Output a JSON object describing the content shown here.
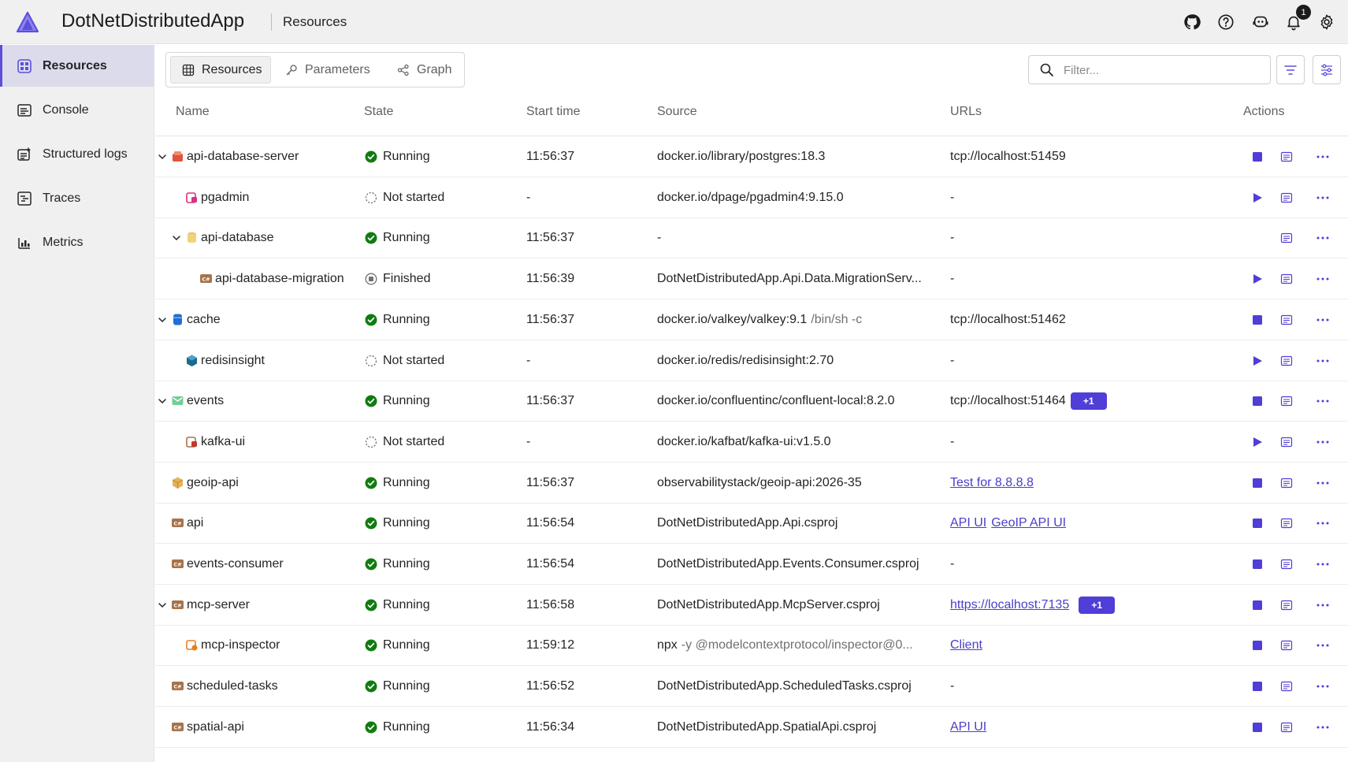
{
  "header": {
    "app_title": "DotNetDistributedApp",
    "crumb": "Resources",
    "notification_count": "1"
  },
  "sidebar": {
    "items": [
      {
        "label": "Resources",
        "icon": "resources-icon",
        "active": true
      },
      {
        "label": "Console",
        "icon": "console-icon",
        "active": false
      },
      {
        "label": "Structured logs",
        "icon": "structured-logs-icon",
        "active": false
      },
      {
        "label": "Traces",
        "icon": "traces-icon",
        "active": false
      },
      {
        "label": "Metrics",
        "icon": "metrics-icon",
        "active": false
      }
    ]
  },
  "tabs": [
    {
      "label": "Resources",
      "icon": "table-icon",
      "active": true
    },
    {
      "label": "Parameters",
      "icon": "key-icon",
      "active": false
    },
    {
      "label": "Graph",
      "icon": "graph-icon",
      "active": false
    }
  ],
  "filter": {
    "placeholder": "Filter..."
  },
  "columns": {
    "name": "Name",
    "state": "State",
    "start_time": "Start time",
    "source": "Source",
    "urls": "URLs",
    "actions": "Actions"
  },
  "colors": {
    "accent": "#5b4fdb",
    "running": "#107c10",
    "link": "#4a3fc7"
  },
  "rows": [
    {
      "name": "api-database-server",
      "level": 0,
      "expanded": true,
      "icon": "postgres-icon",
      "state": "Running",
      "start": "11:56:37",
      "source": "docker.io/library/postgres:18.3",
      "source_extra": "",
      "urls": [
        {
          "text": "tcp://localhost:51459",
          "link": false
        }
      ],
      "plus": "",
      "primary": "stop"
    },
    {
      "name": "pgadmin",
      "level": 1,
      "expanded": null,
      "icon": "pgadmin-icon",
      "state": "Not started",
      "start": "-",
      "source": "docker.io/dpage/pgadmin4:9.15.0",
      "source_extra": "",
      "urls": [
        {
          "text": "-",
          "link": false
        }
      ],
      "plus": "",
      "primary": "start"
    },
    {
      "name": "api-database",
      "level": 1,
      "expanded": true,
      "icon": "database-icon",
      "state": "Running",
      "start": "11:56:37",
      "source": "-",
      "source_extra": "",
      "urls": [
        {
          "text": "-",
          "link": false
        }
      ],
      "plus": "",
      "primary": "none"
    },
    {
      "name": "api-database-migration",
      "level": 2,
      "expanded": null,
      "icon": "csharp-project-icon",
      "state": "Finished",
      "start": "11:56:39",
      "source": "DotNetDistributedApp.Api.Data.MigrationServ...",
      "source_extra": "",
      "urls": [
        {
          "text": "-",
          "link": false
        }
      ],
      "plus": "",
      "primary": "start"
    },
    {
      "name": "cache",
      "level": 0,
      "expanded": true,
      "icon": "valkey-icon",
      "state": "Running",
      "start": "11:56:37",
      "source": "docker.io/valkey/valkey:9.1",
      "source_extra": "/bin/sh -c",
      "urls": [
        {
          "text": "tcp://localhost:51462",
          "link": false
        }
      ],
      "plus": "",
      "primary": "stop"
    },
    {
      "name": "redisinsight",
      "level": 1,
      "expanded": null,
      "icon": "redisinsight-icon",
      "state": "Not started",
      "start": "-",
      "source": "docker.io/redis/redisinsight:2.70",
      "source_extra": "",
      "urls": [
        {
          "text": "-",
          "link": false
        }
      ],
      "plus": "",
      "primary": "start"
    },
    {
      "name": "events",
      "level": 0,
      "expanded": true,
      "icon": "kafka-icon",
      "state": "Running",
      "start": "11:56:37",
      "source": "docker.io/confluentinc/confluent-local:8.2.0",
      "source_extra": "",
      "urls": [
        {
          "text": "tcp://localhost:51464",
          "link": false
        }
      ],
      "plus": "+1",
      "primary": "stop"
    },
    {
      "name": "kafka-ui",
      "level": 1,
      "expanded": null,
      "icon": "kafka-ui-icon",
      "state": "Not started",
      "start": "-",
      "source": "docker.io/kafbat/kafka-ui:v1.5.0",
      "source_extra": "",
      "urls": [
        {
          "text": "-",
          "link": false
        }
      ],
      "plus": "",
      "primary": "start"
    },
    {
      "name": "geoip-api",
      "level": 0,
      "expanded": null,
      "icon": "container-icon",
      "state": "Running",
      "start": "11:56:37",
      "source": "observabilitystack/geoip-api:2026-35",
      "source_extra": "",
      "urls": [
        {
          "text": "Test for 8.8.8.8",
          "link": true
        }
      ],
      "plus": "",
      "primary": "stop"
    },
    {
      "name": "api",
      "level": 0,
      "expanded": null,
      "icon": "csharp-project-icon",
      "state": "Running",
      "start": "11:56:54",
      "source": "DotNetDistributedApp.Api.csproj",
      "source_extra": "",
      "urls": [
        {
          "text": "API UI",
          "link": true
        },
        {
          "text": "GeoIP API UI",
          "link": true
        }
      ],
      "plus": "",
      "primary": "stop"
    },
    {
      "name": "events-consumer",
      "level": 0,
      "expanded": null,
      "icon": "csharp-project-icon",
      "state": "Running",
      "start": "11:56:54",
      "source": "DotNetDistributedApp.Events.Consumer.csproj",
      "source_extra": "",
      "urls": [
        {
          "text": "-",
          "link": false
        }
      ],
      "plus": "",
      "primary": "stop"
    },
    {
      "name": "mcp-server",
      "level": 0,
      "expanded": true,
      "icon": "csharp-project-icon",
      "state": "Running",
      "start": "11:56:58",
      "source": "DotNetDistributedApp.McpServer.csproj",
      "source_extra": "",
      "urls": [
        {
          "text": "https://localhost:7135",
          "link": true
        }
      ],
      "plus": "+1",
      "primary": "stop"
    },
    {
      "name": "mcp-inspector",
      "level": 1,
      "expanded": null,
      "icon": "executable-icon",
      "state": "Running",
      "start": "11:59:12",
      "source": "npx",
      "source_extra": "-y @modelcontextprotocol/inspector@0...",
      "urls": [
        {
          "text": "Client",
          "link": true
        }
      ],
      "plus": "",
      "primary": "stop"
    },
    {
      "name": "scheduled-tasks",
      "level": 0,
      "expanded": null,
      "icon": "csharp-project-icon",
      "state": "Running",
      "start": "11:56:52",
      "source": "DotNetDistributedApp.ScheduledTasks.csproj",
      "source_extra": "",
      "urls": [
        {
          "text": "-",
          "link": false
        }
      ],
      "plus": "",
      "primary": "stop"
    },
    {
      "name": "spatial-api",
      "level": 0,
      "expanded": null,
      "icon": "csharp-project-icon",
      "state": "Running",
      "start": "11:56:34",
      "source": "DotNetDistributedApp.SpatialApi.csproj",
      "source_extra": "",
      "urls": [
        {
          "text": "API UI",
          "link": true
        }
      ],
      "plus": "",
      "primary": "stop"
    }
  ]
}
